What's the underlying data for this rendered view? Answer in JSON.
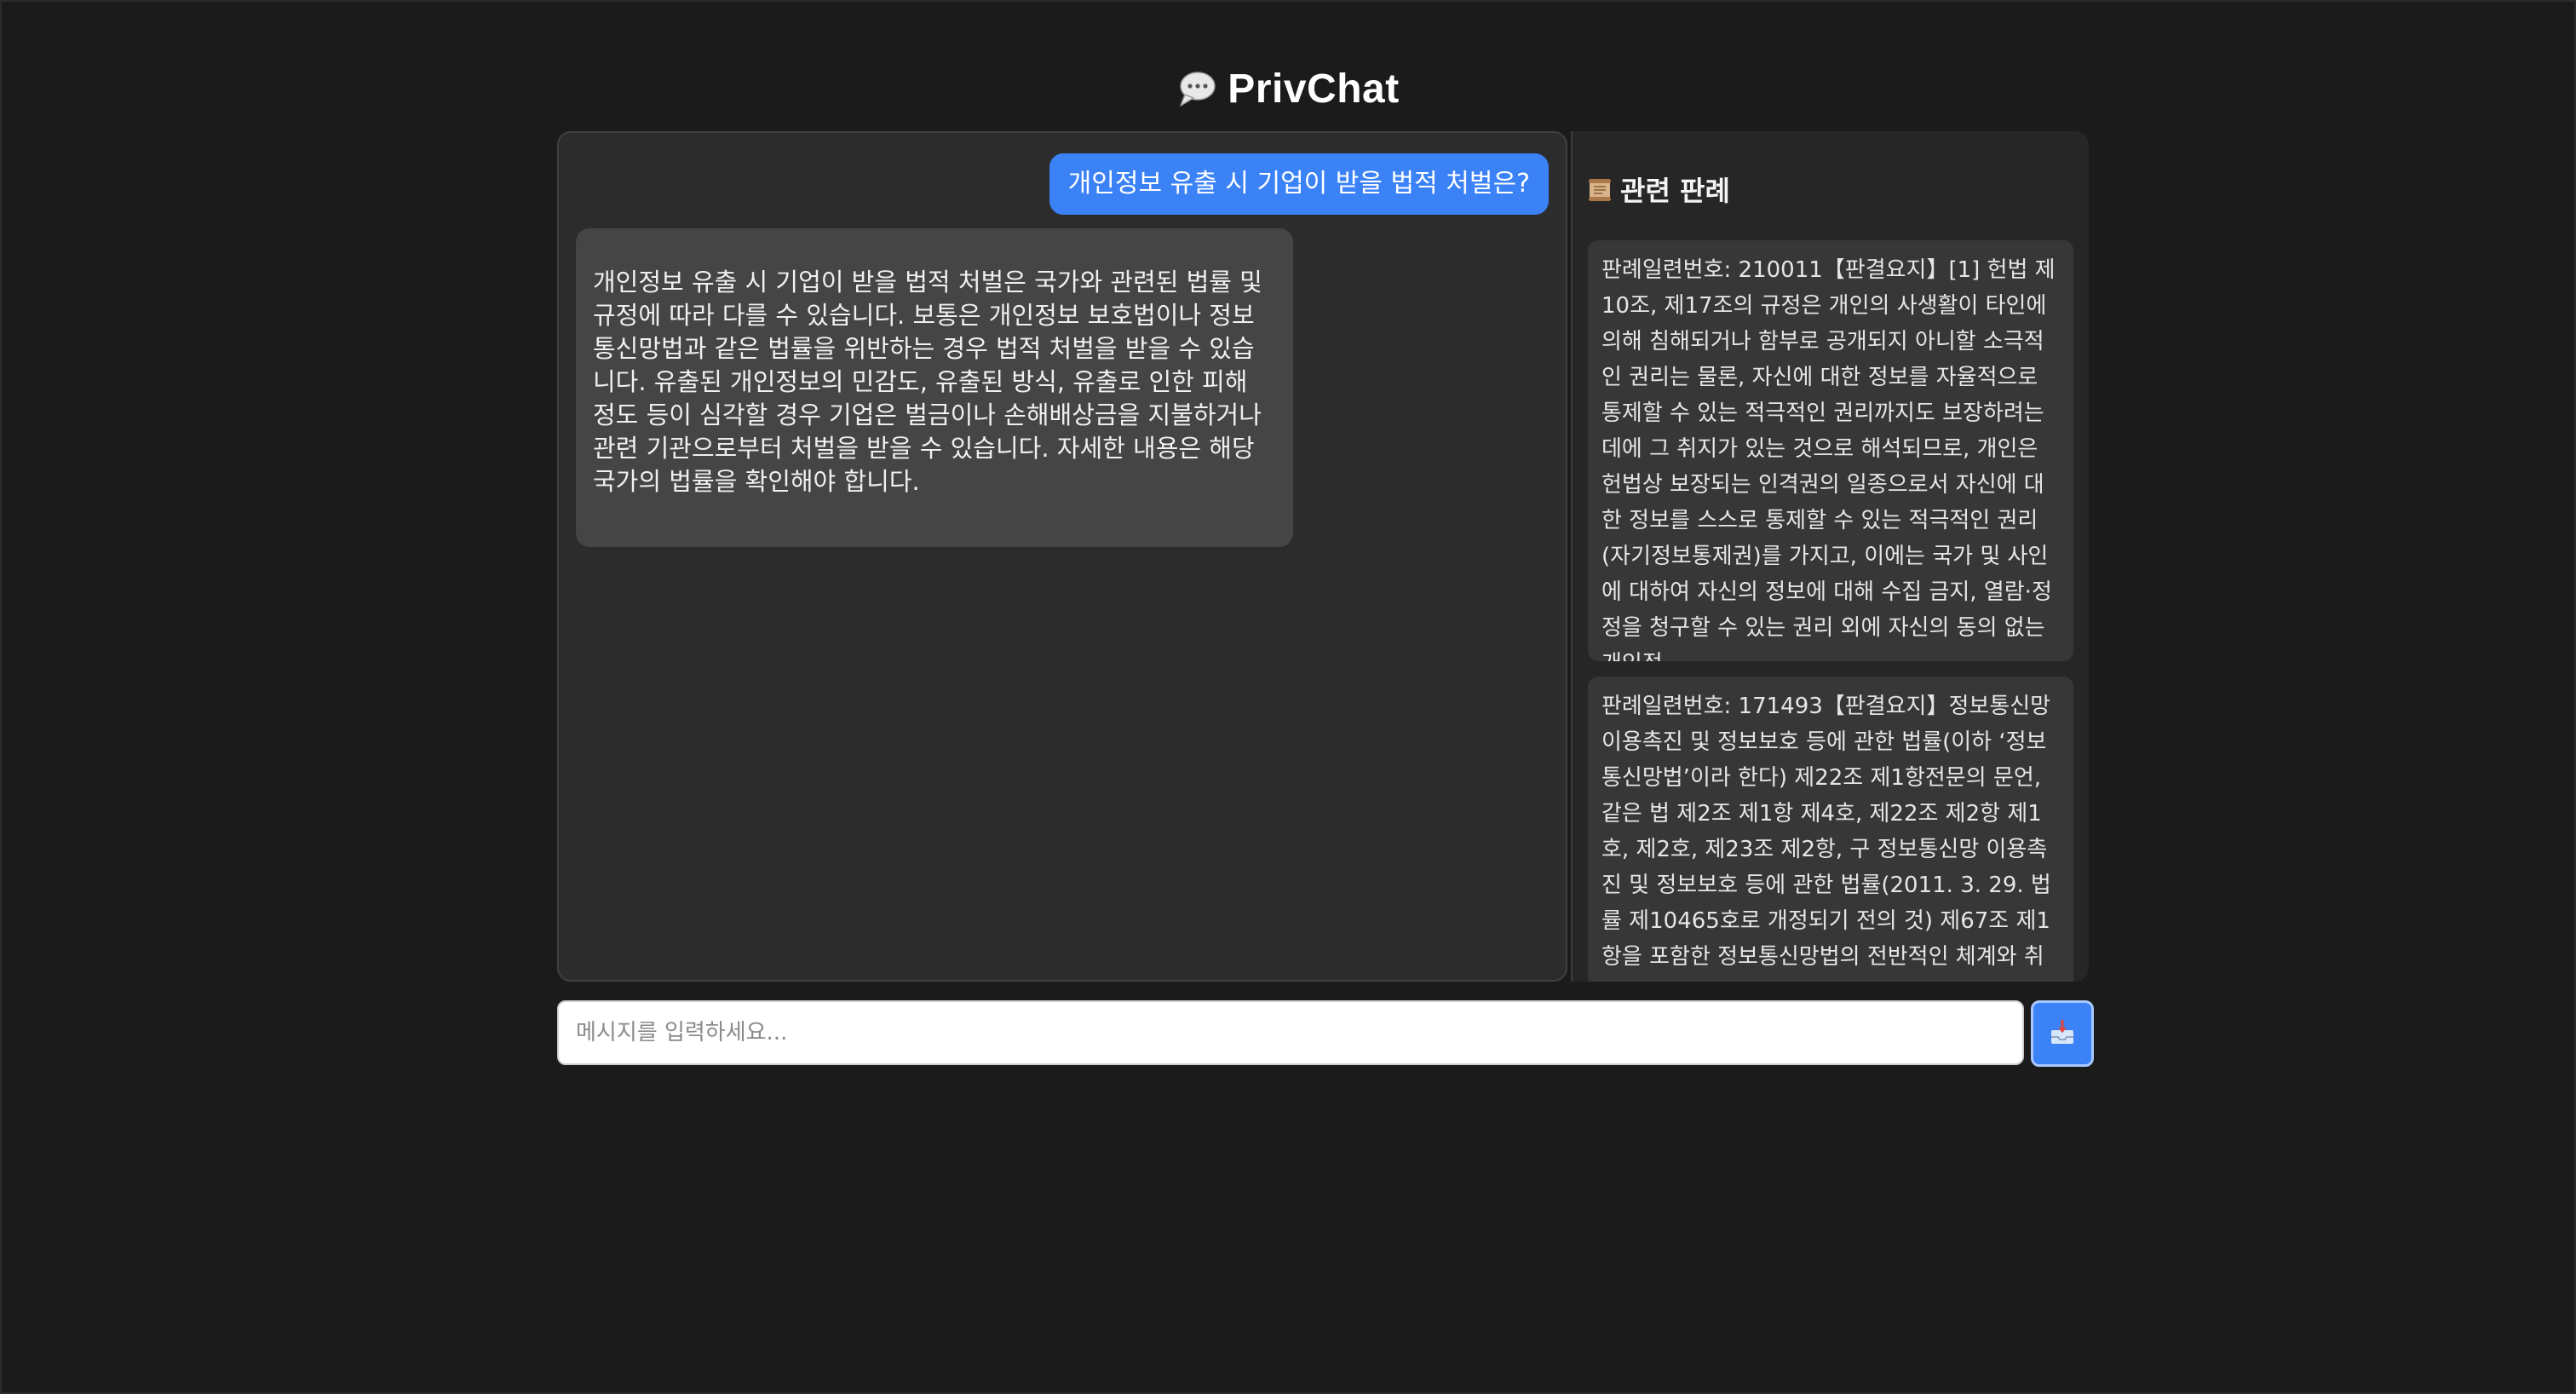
{
  "app": {
    "title": "PrivChat",
    "logo_icon": "speech-bubble-icon"
  },
  "chat": {
    "messages": [
      {
        "role": "user",
        "text": "개인정보 유출 시 기업이 받을 법적 처벌은?"
      },
      {
        "role": "assistant",
        "text": "개인정보 유출 시 기업이 받을 법적 처벌은 국가와 관련된 법률 및 규정에 따라 다를 수 있습니다. 보통은 개인정보 보호법이나 정보통신망법과 같은 법률을 위반하는 경우 법적 처벌을 받을 수 있습니다. 유출된 개인정보의 민감도, 유출된 방식, 유출로 인한 피해 정도 등이 심각할 경우 기업은 벌금이나 손해배상금을 지불하거나 관련 기관으로부터 처벌을 받을 수 있습니다. 자세한 내용은 해당 국가의 법률을 확인해야 합니다."
      }
    ]
  },
  "cases": {
    "title": "관련 판례",
    "title_icon": "scroll-icon",
    "items": [
      {
        "text": "판례일련번호: 210011【판결요지】[1] 헌법 제10조, 제17조의 규정은 개인의 사생활이 타인에 의해 침해되거나 함부로 공개되지 아니할 소극적인 권리는 물론, 자신에 대한 정보를 자율적으로 통제할 수 있는 적극적인 권리까지도 보장하려는 데에 그 취지가 있는 것으로 해석되므로, 개인은 헌법상 보장되는 인격권의 일종으로서 자신에 대한 정보를 스스로 통제할 수 있는 적극적인 권리(자기정보통제권)를 가지고, 이에는 국가 및 사인에 대하여 자신의 정보에 대해 수집 금지, 열람·정정을 청구할 수 있는 권리 외에 자신의 동의 없는 개인정"
      },
      {
        "text": "판례일련번호: 171493【판결요지】정보통신망 이용촉진 및 정보보호 등에 관한 법률(이하 ‘정보통신망법’이라 한다) 제22조 제1항전문의 문언, 같은 법 제2조 제1항 제4호, 제22조 제2항 제1호, 제2호, 제23조 제2항, 구 정보통신망 이용촉진 및 정보보호 등에 관한 법률(2011. 3. 29. 법률 제10465호로 개정되기 전의 것) 제67조 제1항을 포함한 정보통신망법의 전반적인 체계와 취"
      }
    ]
  },
  "composer": {
    "placeholder": "메시지를 입력하세요...",
    "send_icon": "inbox-tray-icon"
  },
  "colors": {
    "background": "#1b1b1b",
    "user_bubble": "#3b82f6",
    "bot_bubble": "#454545",
    "case_card": "#373737"
  }
}
